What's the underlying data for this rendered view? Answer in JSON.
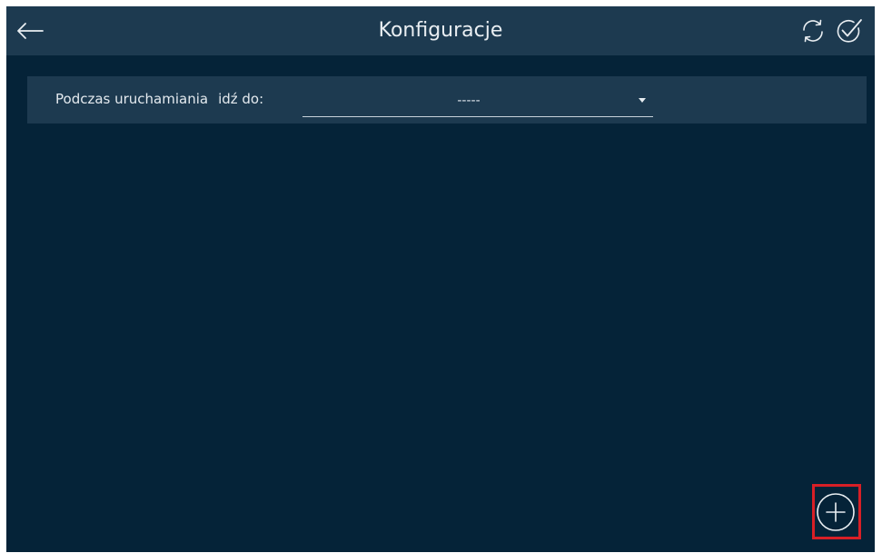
{
  "header": {
    "title": "Konfiguracje",
    "back_icon": "arrow-left-icon",
    "refresh_icon": "refresh-icon",
    "confirm_icon": "check-circle-icon"
  },
  "startup": {
    "label": "Podczas uruchamiania",
    "goto_label": "idź do:",
    "selected_value": "-----",
    "dropdown_icon": "chevron-down-icon"
  },
  "actions": {
    "add_icon": "plus-circle-icon",
    "highlight_color": "#d81f26"
  },
  "colors": {
    "background": "#052338",
    "bar": "#1d3a50",
    "text": "#e9eef2"
  }
}
